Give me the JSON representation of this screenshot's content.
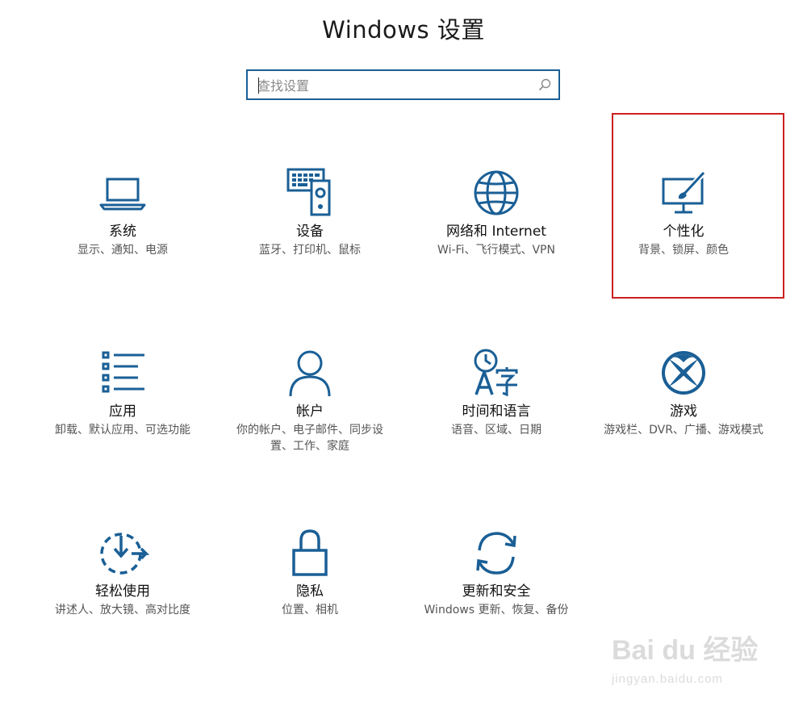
{
  "window": {
    "title": "Windows 设置"
  },
  "search": {
    "placeholder": "查找设置",
    "value": ""
  },
  "colors": {
    "accent": "#1a5f96",
    "highlight_border": "#cc1f1f"
  },
  "tiles": [
    {
      "icon": "laptop-icon",
      "name": "系统",
      "desc": "显示、通知、电源"
    },
    {
      "icon": "keyboard-speaker-icon",
      "name": "设备",
      "desc": "蓝牙、打印机、鼠标"
    },
    {
      "icon": "globe-icon",
      "name": "网络和 Internet",
      "desc": "Wi-Fi、飞行模式、VPN"
    },
    {
      "icon": "paintbrush-monitor-icon",
      "name": "个性化",
      "desc": "背景、锁屏、颜色"
    },
    {
      "icon": "app-list-icon",
      "name": "应用",
      "desc": "卸载、默认应用、可选功能"
    },
    {
      "icon": "person-icon",
      "name": "帐户",
      "desc": "你的帐户、电子邮件、同步设置、工作、家庭"
    },
    {
      "icon": "clock-language-icon",
      "name": "时间和语言",
      "desc": "语音、区域、日期"
    },
    {
      "icon": "xbox-icon",
      "name": "游戏",
      "desc": "游戏栏、DVR、广播、游戏模式"
    },
    {
      "icon": "ease-of-access-icon",
      "name": "轻松使用",
      "desc": "讲述人、放大镜、高对比度"
    },
    {
      "icon": "lock-icon",
      "name": "隐私",
      "desc": "位置、相机"
    },
    {
      "icon": "sync-arrows-icon",
      "name": "更新和安全",
      "desc": "Windows 更新、恢复、备份"
    }
  ],
  "watermark": {
    "brand": "Bai du 经验",
    "url": "jingyan.baidu.com"
  }
}
